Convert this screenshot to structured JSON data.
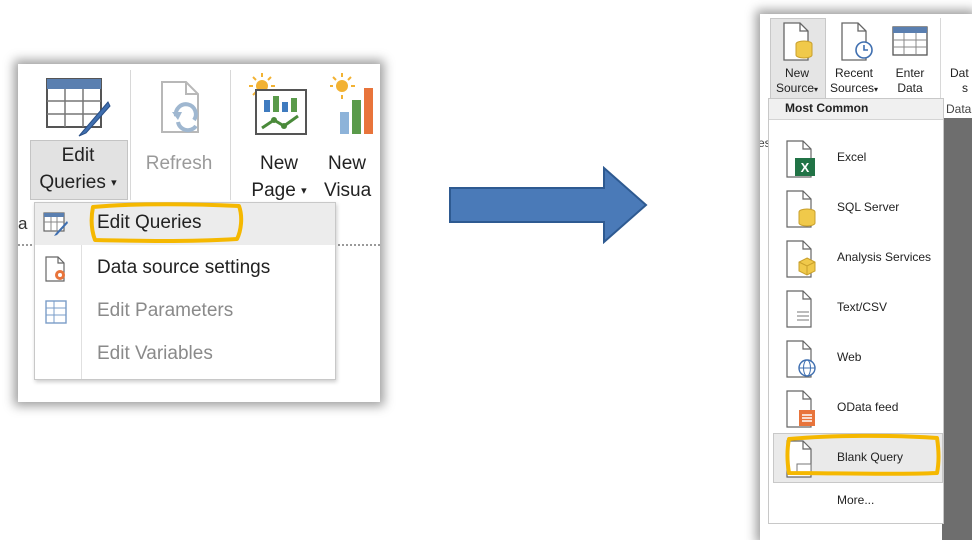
{
  "left_ribbon": {
    "edit_queries_line1": "Edit",
    "edit_queries_line2": "Queries",
    "refresh": "Refresh",
    "new_page_line1": "New",
    "new_page_line2": "Page",
    "new_visual_line1": "New",
    "new_visual_line2": "Visua",
    "caret": "▾",
    "dropdown": [
      {
        "label": "Edit Queries",
        "icon": "edit-queries-icon",
        "enabled": true,
        "highlighted": true
      },
      {
        "label": "Data source settings",
        "icon": "data-source-settings-icon",
        "enabled": true
      },
      {
        "label": "Edit Parameters",
        "icon": "edit-parameters-icon",
        "enabled": false
      },
      {
        "label": "Edit Variables",
        "icon": "",
        "enabled": false
      }
    ]
  },
  "right_ribbon": {
    "new_source_line1": "New",
    "new_source_line2": "Source",
    "recent_sources_line1": "Recent",
    "recent_sources_line2": "Sources",
    "enter_data_line1": "Enter",
    "enter_data_line2": "Data",
    "partial_button_line1": "Dat",
    "partial_button_line2": "s",
    "group_label_partial": "Data",
    "left_edge_fragment": "es",
    "caret": "▾",
    "menu_header": "Most Common",
    "items": [
      {
        "label": "Excel",
        "icon": "excel-icon"
      },
      {
        "label": "SQL Server",
        "icon": "sql-server-icon"
      },
      {
        "label": "Analysis Services",
        "icon": "analysis-services-icon"
      },
      {
        "label": "Text/CSV",
        "icon": "text-csv-icon"
      },
      {
        "label": "Web",
        "icon": "web-icon"
      },
      {
        "label": "OData feed",
        "icon": "odata-feed-icon"
      },
      {
        "label": "Blank Query",
        "icon": "blank-query-icon",
        "highlighted": true
      }
    ],
    "more": "More..."
  },
  "colors": {
    "highlight_marker": "#f5b800",
    "arrow_fill": "#4a7ab8",
    "arrow_stroke": "#2e5a91",
    "excel_green": "#217346",
    "database_yellow": "#f0c94a",
    "odata_orange": "#e8743b"
  }
}
